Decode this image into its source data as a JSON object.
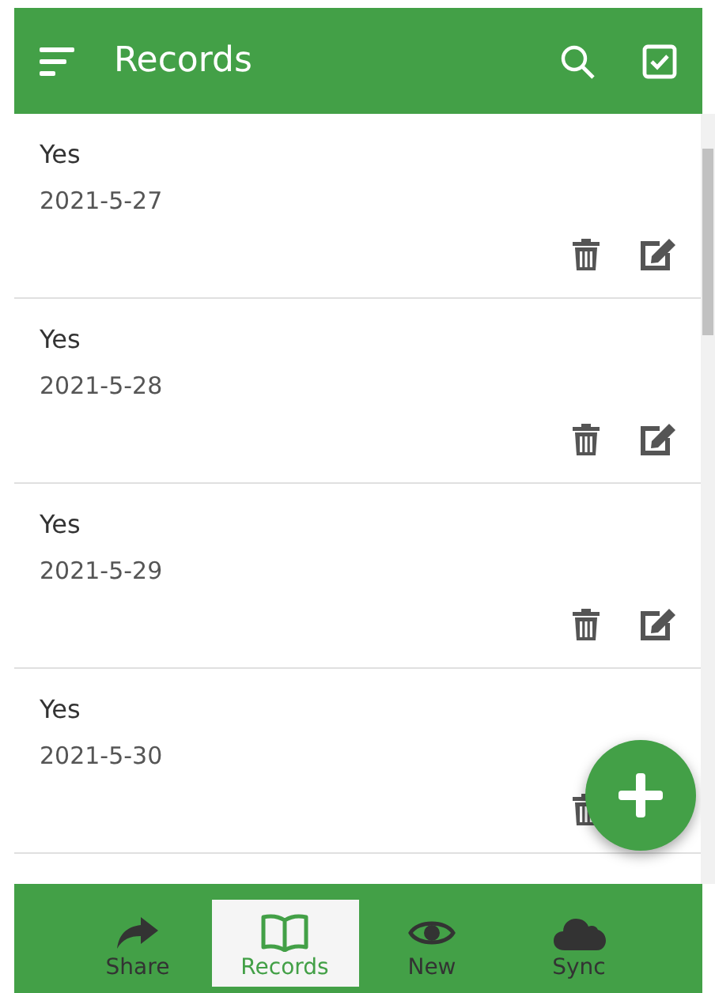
{
  "header": {
    "title": "Records"
  },
  "records": [
    {
      "title": "Yes",
      "date": "2021-5-27"
    },
    {
      "title": "Yes",
      "date": "2021-5-28"
    },
    {
      "title": "Yes",
      "date": "2021-5-29"
    },
    {
      "title": "Yes",
      "date": "2021-5-30"
    }
  ],
  "nav": [
    {
      "kind": "share",
      "label": "Share",
      "selected": false
    },
    {
      "kind": "book",
      "label": "Records",
      "selected": true
    },
    {
      "kind": "eye",
      "label": "New",
      "selected": false
    },
    {
      "kind": "cloud",
      "label": "Sync",
      "selected": false
    }
  ]
}
